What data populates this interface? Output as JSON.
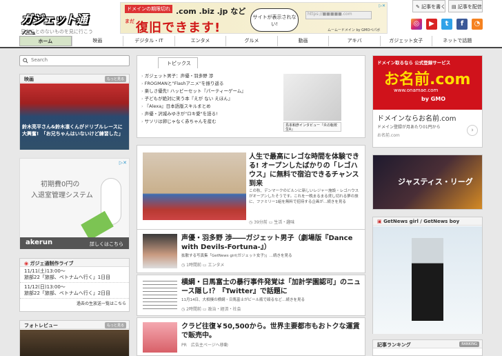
{
  "header": {
    "logo_text": "ガジェット通信",
    "tagline": "見たことのないものを見に行こう",
    "write_btn": "記事を書く",
    "pr_btn": "記事を配信",
    "social": [
      "instagram-icon",
      "youtube-icon",
      "twitter-icon",
      "facebook-icon",
      "rss-icon"
    ]
  },
  "top_ad": {
    "line1_badge": "ドメインの期限切れ",
    "line1_text": ".com .biz .jp など",
    "line2_prefix": "まだ",
    "line2": "復旧できます!",
    "bubble": "サイトが表示されない!",
    "url_bar": "https://■■■■■.com",
    "footer": "ムームードメイン by GMOペパボ"
  },
  "nav": {
    "items": [
      "ホーム",
      "映画",
      "デジタル・IT",
      "エンタメ",
      "グルメ",
      "動画",
      "アキバ",
      "ガジェット女子",
      "ネットで話題"
    ]
  },
  "search": {
    "placeholder": "Search"
  },
  "left": {
    "eiga": {
      "title": "映画",
      "more": "もっと見る",
      "caption": "鈴木亮平さん&鈴木凛くんがドリブルレースに大興奮!　「お兄ちゃんはいないけど練習した」"
    },
    "akerun": {
      "line1": "初期費0円の",
      "line2": "入退室管理システム",
      "brand": "akerun",
      "link": "詳しくはこちら"
    },
    "live": {
      "title": "ガジェ通制作ライブ",
      "items": [
        {
          "date": "11/11(土)13:00〜",
          "text": "旅部22「旅部、ベトナムへ行く」1日目"
        },
        {
          "date": "11/12(日)13:00〜",
          "text": "旅部22「旅部、ベトナムへ行く」2日目"
        }
      ],
      "footer": "過去の生放送一覧はこちら"
    },
    "photo": {
      "title": "フォトレビュー",
      "more": "もっと見る"
    }
  },
  "topics": {
    "tab": "トピックス",
    "items": [
      "ガジェット男子：声優・羽多野 渉",
      "FROGMANと\"Flashアニメ\"を振り返る",
      "楽しさ優先! ハッピーセット『パーティーゲーム』",
      "子どもが絶対に笑う本『えが ない えほん』",
      "『Alexa』日本語版スキルまとめ",
      "声優・沢城みゆきが\"ロキ愛\"を語る!",
      "サソリは卵じゃなく赤ちゃんを産む"
    ],
    "pic_caption": "島本和彦インタビュー『炎の転校生R』"
  },
  "articles": [
    {
      "title": "人生で最高にレゴな時間を体験できる! オープンしたばかりの「レゴハウス」に無料で宿泊できるチャンス到来",
      "summary": "この秋、デンマークのビルンに新しいレジャー施設・レゴハウスがオープンしたそうです。これを一晩まるまる貸し切れる夢の旅に、ファミリー1組を無料で招待する企画が…続きを見る",
      "time": "39分前",
      "cat": "生活・趣味"
    },
    {
      "title": "声優・羽多野 渉――ガジェット男子（劇場版『Dance with Devils-Fortuna-』）",
      "summary": "拡散する写真集「GetNews girl(ガジェット女子)」…続きを見る",
      "time": "1時間前",
      "cat": "エンタメ"
    },
    {
      "title": "横綱・日馬富士の暴行事件発覚は「加計学園認可」のニュース隠し!？『Twitter』で話題に",
      "summary": "11月14日、大相撲の横綱・日馬富士がビール瓶で殴るなど…続きを見る",
      "time": "2時間前",
      "cat": "政治・経済・社会"
    },
    {
      "title": "クラビ往復￥50,500から。世界主要都市もおトクな運賃で販売中。",
      "pr": "PR",
      "sponsor": "広告主ページへ移動"
    }
  ],
  "right": {
    "ad1": {
      "top": "ドメイン取るなら 公式登録サービス",
      "brand": "お名前.com",
      "url": "www.onamae.com",
      "by": "by GMO",
      "headline": "ドメインならお名前.com",
      "sub": "ドメイン登録が月あたり01円から",
      "domain": "お名前.com"
    },
    "ad2": {
      "title": "ジャスティス・リーグ"
    },
    "getnews": {
      "title": "GetNews girl / GetNews boy"
    },
    "ranking": {
      "title": "記事ランキング",
      "badge": "RANKING"
    }
  }
}
